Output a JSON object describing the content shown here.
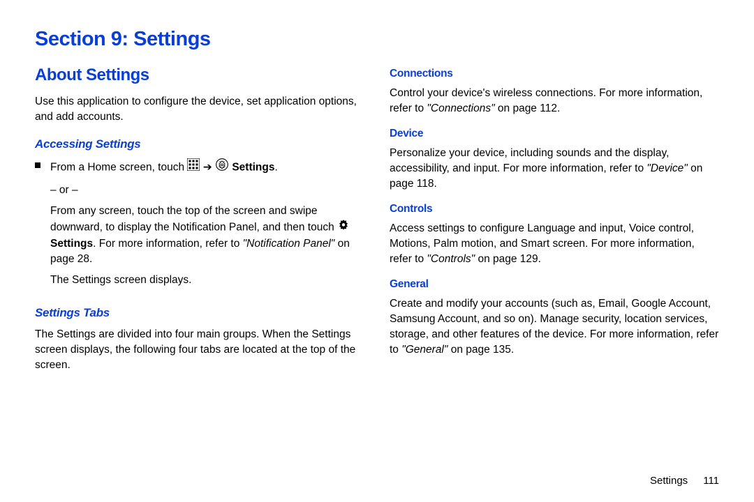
{
  "section_title": "Section 9: Settings",
  "left": {
    "about_heading": "About Settings",
    "about_body": "Use this application to configure the device, set application options, and add accounts.",
    "accessing_heading": "Accessing Settings",
    "step_prefix": "From a Home screen, touch ",
    "step_arrow": " ➔ ",
    "step_settings_label": "Settings",
    "step_period": ".",
    "or_text": "– or –",
    "from_any_1": "From any screen, touch the top of the screen and swipe downward, to display the Notification Panel, and then touch ",
    "from_any_settings": "Settings",
    "from_any_2": ". For more information, refer to ",
    "notif_ref": "\"Notification Panel\"",
    "notif_page": " on page 28.",
    "result_text": "The Settings screen displays.",
    "tabs_heading": "Settings Tabs",
    "tabs_body": "The Settings are divided into four main groups. When the Settings screen displays, the following four tabs are located at the top of the screen."
  },
  "right": {
    "conn_heading": "Connections",
    "conn_body_1": "Control your device's wireless connections. For more information, refer to ",
    "conn_ref": "\"Connections\"",
    "conn_page": " on page 112.",
    "device_heading": "Device",
    "device_body_1": "Personalize your device, including sounds and the display, accessibility, and input. For more information, refer to ",
    "device_ref": "\"Device\"",
    "device_page": " on page 118.",
    "controls_heading": "Controls",
    "controls_body_1": "Access settings to configure Language and input, Voice control, Motions, Palm motion, and Smart screen. For more information, refer to ",
    "controls_ref": "\"Controls\"",
    "controls_page": " on page 129.",
    "general_heading": "General",
    "general_body_1": "Create and modify your accounts (such as, Email, Google Account, Samsung Account, and so on). Manage security, location services, storage, and other features of the device. For more information, refer to ",
    "general_ref": "\"General\"",
    "general_page": " on page 135."
  },
  "footer": {
    "label": "Settings",
    "page": "111"
  }
}
